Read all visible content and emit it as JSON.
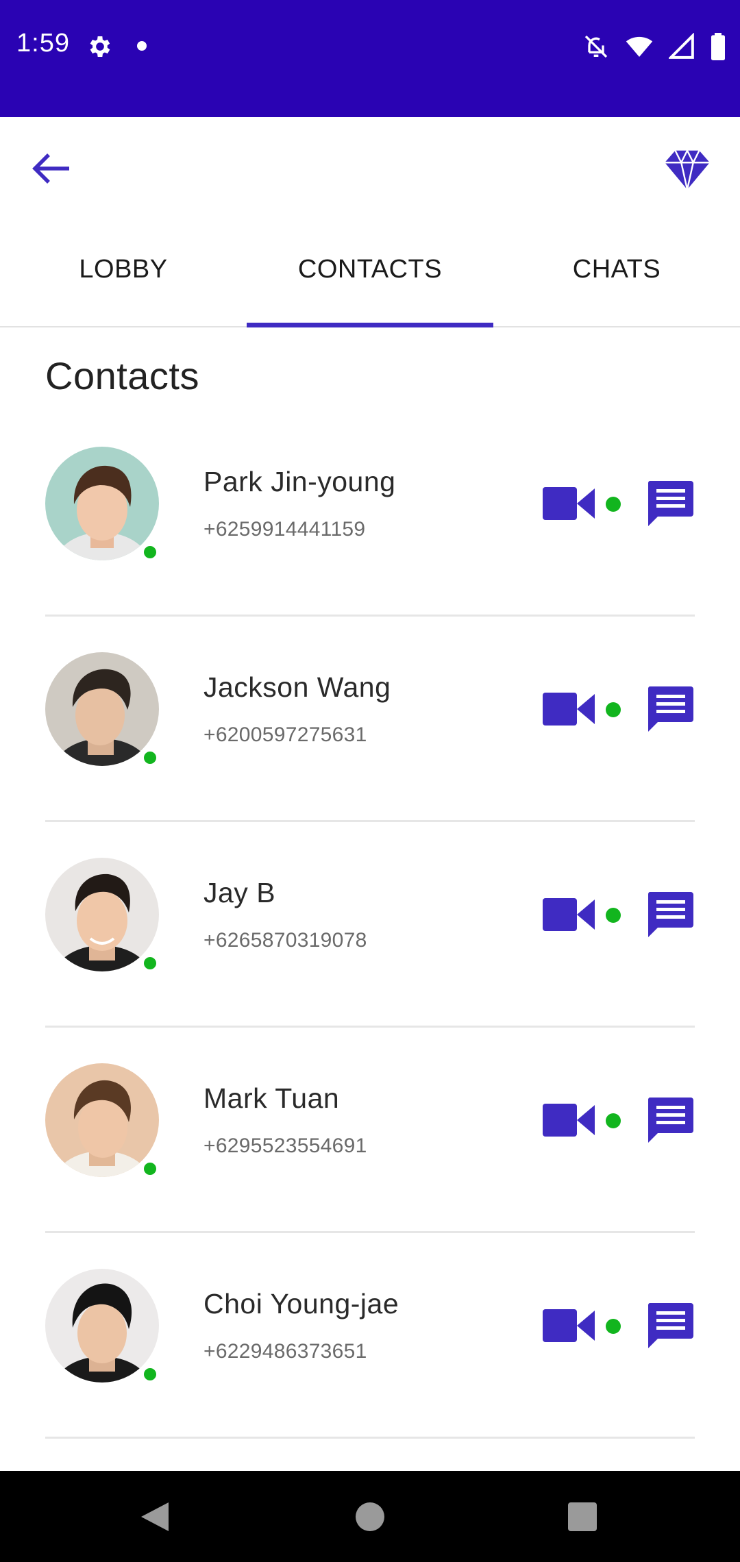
{
  "status_bar": {
    "time": "1:59",
    "icons": [
      "gear-icon",
      "notification-dot",
      "notifications-off-icon",
      "wifi-icon",
      "signal-icon",
      "battery-icon"
    ],
    "background_color": "#2a03b3"
  },
  "app_bar": {
    "back_icon": "arrow-left-icon",
    "premium_icon": "diamond-icon",
    "accent_color": "#3f2bc2"
  },
  "tabs": [
    {
      "label": "LOBBY",
      "active": false
    },
    {
      "label": "CONTACTS",
      "active": true
    },
    {
      "label": "CHATS",
      "active": false
    }
  ],
  "section_title": "Contacts",
  "contacts": [
    {
      "name": "Park Jin-young",
      "phone": "+6259914441159",
      "online": true
    },
    {
      "name": "Jackson Wang",
      "phone": "+6200597275631",
      "online": true
    },
    {
      "name": "Jay B",
      "phone": "+6265870319078",
      "online": true
    },
    {
      "name": "Mark Tuan",
      "phone": "+6295523554691",
      "online": true
    },
    {
      "name": "Choi Young-jae",
      "phone": "+6229486373651",
      "online": true
    }
  ],
  "colors": {
    "online": "#12b51e",
    "icon": "#3f2bc2"
  },
  "nav_bar": {
    "icons": [
      "nav-back-icon",
      "nav-home-icon",
      "nav-recents-icon"
    ]
  }
}
